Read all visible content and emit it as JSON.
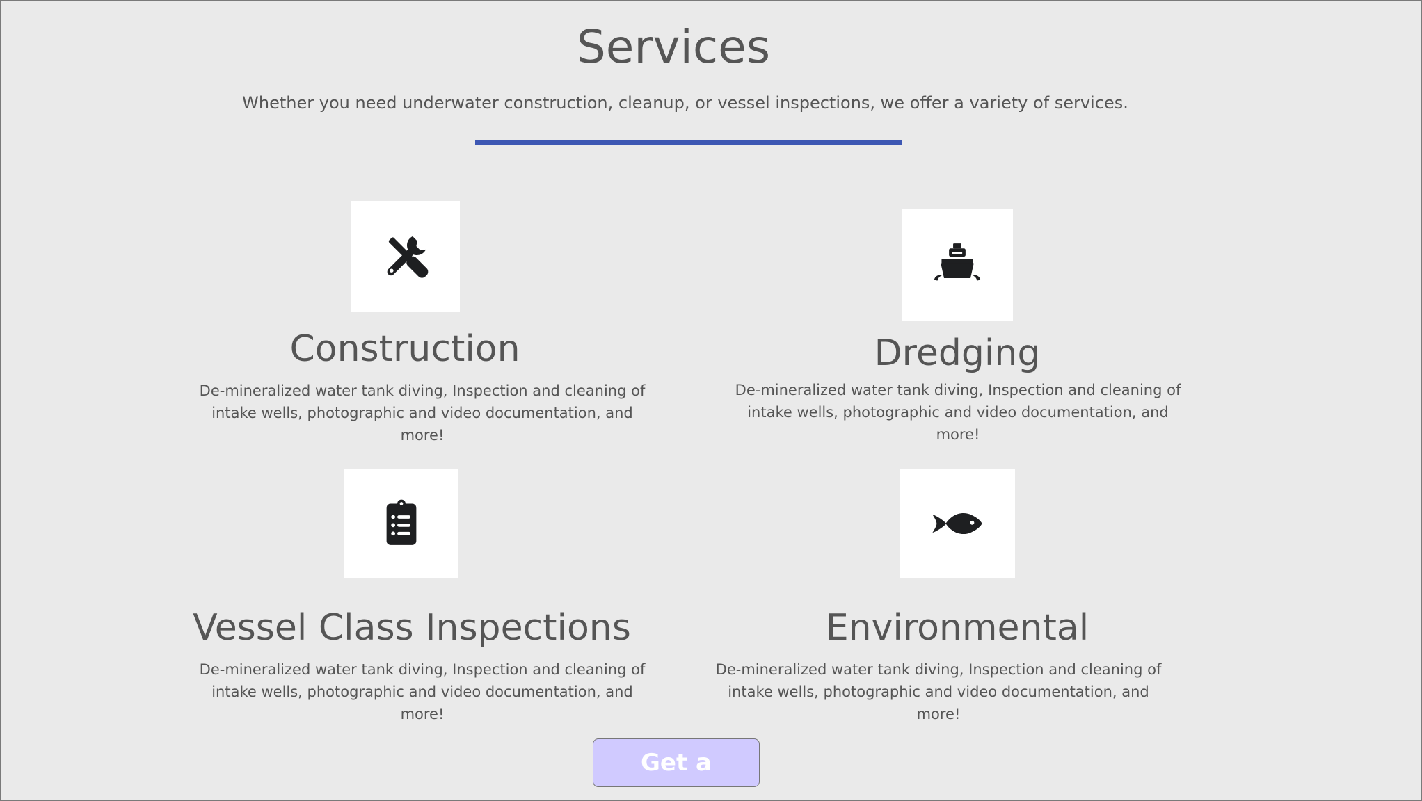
{
  "header": {
    "title": "Services",
    "subtitle": "Whether you need underwater construction, cleanup, or vessel inspections, we offer a variety of services."
  },
  "colors": {
    "background": "#eaeaea",
    "divider": "#3d57b3",
    "text": "#555555",
    "icon": "#1e1f21",
    "button_bg": "#d0caff",
    "button_text": "#ffffff"
  },
  "services": [
    {
      "icon": "tools-icon",
      "title": "Construction",
      "description": "De-mineralized water tank diving,  Inspection and cleaning of intake wells,  photographic and video documentation,  and more!"
    },
    {
      "icon": "ship-icon",
      "title": "Dredging",
      "description": "De-mineralized water tank diving,  Inspection and cleaning of intake wells,  photographic and video documentation,  and more!"
    },
    {
      "icon": "clipboard-list-icon",
      "title": "Vessel Class Inspections",
      "description": "De-mineralized water tank diving,  Inspection and cleaning of intake wells,  photographic and video documentation,  and more!"
    },
    {
      "icon": "fish-icon",
      "title": "Environmental",
      "description": "De-mineralized water tank diving,  Inspection and cleaning of intake wells,  photographic and video documentation,  and more!"
    }
  ],
  "cta": {
    "label": "Get a quote!"
  }
}
